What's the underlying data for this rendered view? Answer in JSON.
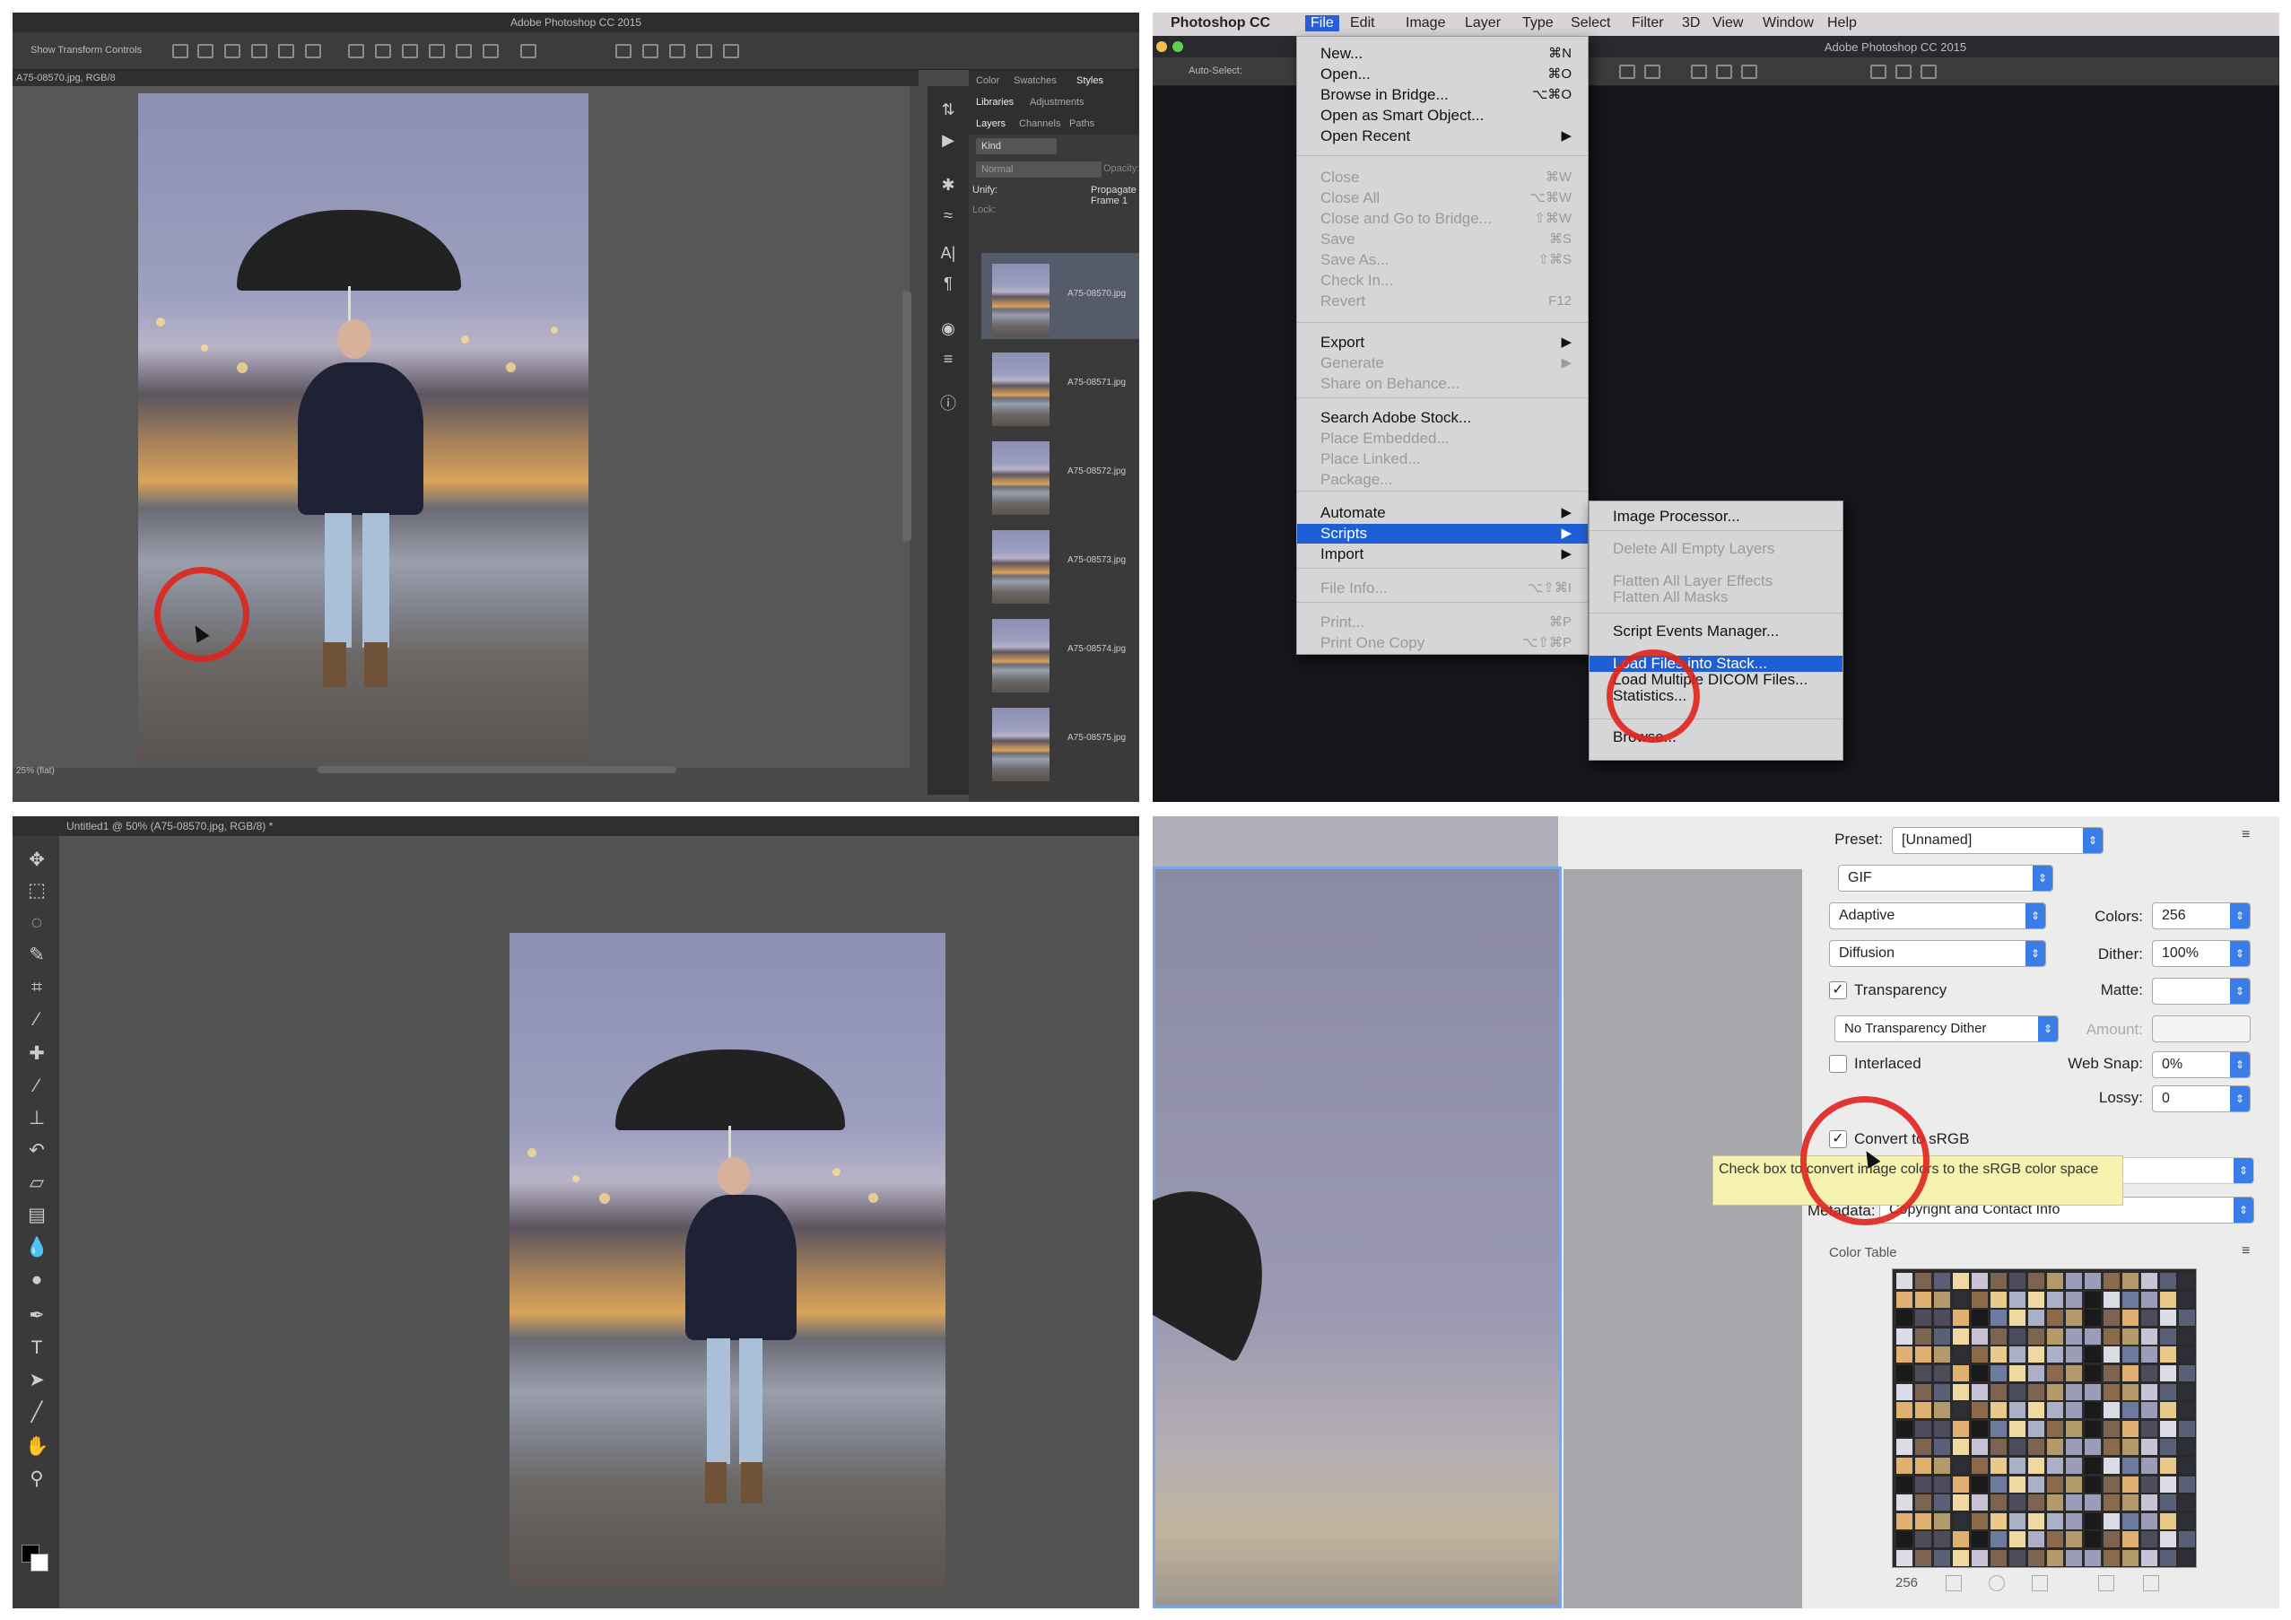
{
  "q1": {
    "app_title": "Adobe Photoshop CC 2015",
    "options_label": "Show Transform Controls",
    "doc_tab": "A75-08570.jpg, RGB/8",
    "status": "25% (flat)",
    "panel_tabs_row1": [
      "Color",
      "Swatches",
      "Styles"
    ],
    "panel_tabs_row2": [
      "Libraries",
      "Adjustments"
    ],
    "panel_tabs_row3": [
      "Layers",
      "Channels",
      "Paths"
    ],
    "kind_label": "Kind",
    "blend_mode": "Normal",
    "opacity_label": "Opacity:",
    "unify_label": "Unify:",
    "propagate_label": "Propagate Frame 1",
    "lock_label": "Lock:",
    "layers": [
      "A75-08570.jpg",
      "A75-08571.jpg",
      "A75-08572.jpg",
      "A75-08573.jpg",
      "A75-08574.jpg",
      "A75-08575.jpg"
    ]
  },
  "q2": {
    "app_title": "Adobe Photoshop CC 2015",
    "menubar": [
      "Photoshop CC",
      "File",
      "Edit",
      "Image",
      "Layer",
      "Type",
      "Select",
      "Filter",
      "3D",
      "View",
      "Window",
      "Help"
    ],
    "auto_select": "Auto-Select:",
    "file_menu": [
      {
        "label": "New...",
        "shortcut": "⌘N",
        "enabled": true
      },
      {
        "label": "Open...",
        "shortcut": "⌘O",
        "enabled": true
      },
      {
        "label": "Browse in Bridge...",
        "shortcut": "⌥⌘O",
        "enabled": true
      },
      {
        "label": "Open as Smart Object...",
        "shortcut": "",
        "enabled": true
      },
      {
        "label": "Open Recent",
        "shortcut": "▶",
        "enabled": true
      },
      {
        "label": "Close",
        "shortcut": "⌘W",
        "enabled": false
      },
      {
        "label": "Close All",
        "shortcut": "⌥⌘W",
        "enabled": false
      },
      {
        "label": "Close and Go to Bridge...",
        "shortcut": "⇧⌘W",
        "enabled": false
      },
      {
        "label": "Save",
        "shortcut": "⌘S",
        "enabled": false
      },
      {
        "label": "Save As...",
        "shortcut": "⇧⌘S",
        "enabled": false
      },
      {
        "label": "Check In...",
        "shortcut": "",
        "enabled": false
      },
      {
        "label": "Revert",
        "shortcut": "F12",
        "enabled": false
      },
      {
        "label": "Export",
        "shortcut": "▶",
        "enabled": true
      },
      {
        "label": "Generate",
        "shortcut": "▶",
        "enabled": false
      },
      {
        "label": "Share on Behance...",
        "shortcut": "",
        "enabled": false
      },
      {
        "label": "Search Adobe Stock...",
        "shortcut": "",
        "enabled": true
      },
      {
        "label": "Place Embedded...",
        "shortcut": "",
        "enabled": false
      },
      {
        "label": "Place Linked...",
        "shortcut": "",
        "enabled": false
      },
      {
        "label": "Package...",
        "shortcut": "",
        "enabled": false
      },
      {
        "label": "Automate",
        "shortcut": "▶",
        "enabled": true
      },
      {
        "label": "Scripts",
        "shortcut": "▶",
        "enabled": true
      },
      {
        "label": "Import",
        "shortcut": "▶",
        "enabled": true
      },
      {
        "label": "File Info...",
        "shortcut": "⌥⇧⌘I",
        "enabled": false
      },
      {
        "label": "Print...",
        "shortcut": "⌘P",
        "enabled": false
      },
      {
        "label": "Print One Copy",
        "shortcut": "⌥⇧⌘P",
        "enabled": false
      }
    ],
    "scripts_menu": [
      {
        "label": "Image Processor...",
        "enabled": true
      },
      {
        "label": "Delete All Empty Layers",
        "enabled": false
      },
      {
        "label": "Flatten All Layer Effects",
        "enabled": false
      },
      {
        "label": "Flatten All Masks",
        "enabled": false
      },
      {
        "label": "Script Events Manager...",
        "enabled": true
      },
      {
        "label": "Load Files into Stack...",
        "enabled": true
      },
      {
        "label": "Load Multiple DICOM Files...",
        "enabled": true
      },
      {
        "label": "Statistics...",
        "enabled": true
      },
      {
        "label": "Browse...",
        "enabled": true
      }
    ]
  },
  "q3": {
    "doc_tab": "Untitled1 @ 50% (A75-08570.jpg, RGB/8) *"
  },
  "q4": {
    "preset_label": "Preset:",
    "preset_value": "[Unnamed]",
    "format_value": "GIF",
    "reduction_value": "Adaptive",
    "colors_label": "Colors:",
    "colors_value": "256",
    "dither_algo": "Diffusion",
    "dither_label": "Dither:",
    "dither_value": "100%",
    "transparency_label": "Transparency",
    "matte_label": "Matte:",
    "transparency_dither": "No Transparency Dither",
    "amount_label": "Amount:",
    "interlaced_label": "Interlaced",
    "websnap_label": "Web Snap:",
    "websnap_value": "0%",
    "lossy_label": "Lossy:",
    "lossy_value": "0",
    "convert_label": "Convert to sRGB",
    "tooltip": "Check box to convert image colors to the sRGB color space",
    "metadata_label": "Metadata:",
    "metadata_value": "Copyright and Contact Info",
    "color_table_label": "Color Table",
    "color_count": "256"
  }
}
